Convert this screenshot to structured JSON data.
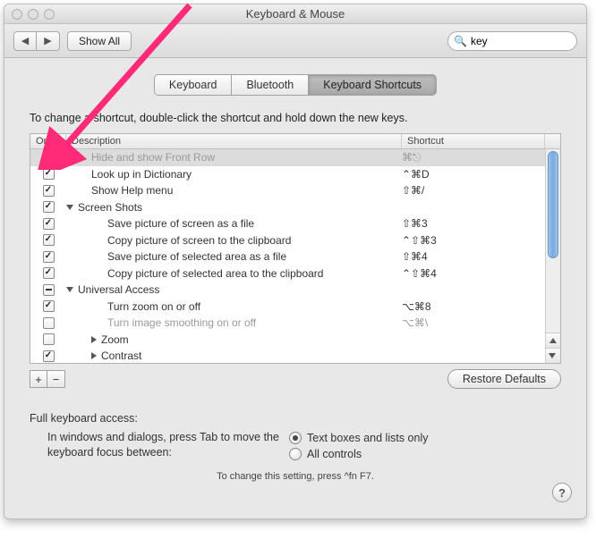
{
  "window": {
    "title": "Keyboard & Mouse"
  },
  "toolbar": {
    "show_all": "Show All",
    "search": {
      "placeholder": "",
      "value": "key"
    }
  },
  "tabs": {
    "items": [
      "Keyboard",
      "Bluetooth",
      "Keyboard Shortcuts"
    ],
    "active_index": 2
  },
  "instruction": "To change a shortcut, double-click the shortcut and hold down the new keys.",
  "columns": {
    "on": "On",
    "description": "Description",
    "shortcut": "Shortcut"
  },
  "rows": [
    {
      "check": "off",
      "indent": 1,
      "disclosure": "",
      "label": "Hide and show Front Row",
      "shortcut": "⌘⎋",
      "disabled": true,
      "selected": true
    },
    {
      "check": "on",
      "indent": 1,
      "disclosure": "",
      "label": "Look up in Dictionary",
      "shortcut": "⌃⌘D",
      "disabled": false,
      "selected": false
    },
    {
      "check": "on",
      "indent": 1,
      "disclosure": "",
      "label": "Show Help menu",
      "shortcut": "⇧⌘/",
      "disabled": false,
      "selected": false
    },
    {
      "check": "on",
      "indent": 0,
      "disclosure": "down",
      "label": "Screen Shots",
      "shortcut": "",
      "disabled": false,
      "selected": false
    },
    {
      "check": "on",
      "indent": 2,
      "disclosure": "",
      "label": "Save picture of screen as a file",
      "shortcut": "⇧⌘3",
      "disabled": false,
      "selected": false
    },
    {
      "check": "on",
      "indent": 2,
      "disclosure": "",
      "label": "Copy picture of screen to the clipboard",
      "shortcut": "⌃⇧⌘3",
      "disabled": false,
      "selected": false
    },
    {
      "check": "on",
      "indent": 2,
      "disclosure": "",
      "label": "Save picture of selected area as a file",
      "shortcut": "⇧⌘4",
      "disabled": false,
      "selected": false
    },
    {
      "check": "on",
      "indent": 2,
      "disclosure": "",
      "label": "Copy picture of selected area to the clipboard",
      "shortcut": "⌃⇧⌘4",
      "disabled": false,
      "selected": false
    },
    {
      "check": "mixed",
      "indent": 0,
      "disclosure": "down",
      "label": "Universal Access",
      "shortcut": "",
      "disabled": false,
      "selected": false
    },
    {
      "check": "on",
      "indent": 2,
      "disclosure": "",
      "label": "Turn zoom on or off",
      "shortcut": "⌥⌘8",
      "disabled": false,
      "selected": false
    },
    {
      "check": "off",
      "indent": 2,
      "disclosure": "",
      "label": "Turn image smoothing on or off",
      "shortcut": "⌥⌘\\",
      "disabled": true,
      "selected": false
    },
    {
      "check": "off",
      "indent": 1,
      "disclosure": "right",
      "label": "Zoom",
      "shortcut": "",
      "disabled": false,
      "selected": false
    },
    {
      "check": "on",
      "indent": 1,
      "disclosure": "right",
      "label": "Contrast",
      "shortcut": "",
      "disabled": false,
      "selected": false
    }
  ],
  "buttons": {
    "add": "+",
    "remove": "−",
    "restore_defaults": "Restore Defaults"
  },
  "full_keyboard_access": {
    "heading": "Full keyboard access:",
    "blurb": "In windows and dialogs, press Tab to move the keyboard focus between:",
    "options": {
      "textboxes": "Text boxes and lists only",
      "all": "All controls"
    },
    "selected": "textboxes",
    "tip": "To change this setting, press ^fn F7."
  }
}
